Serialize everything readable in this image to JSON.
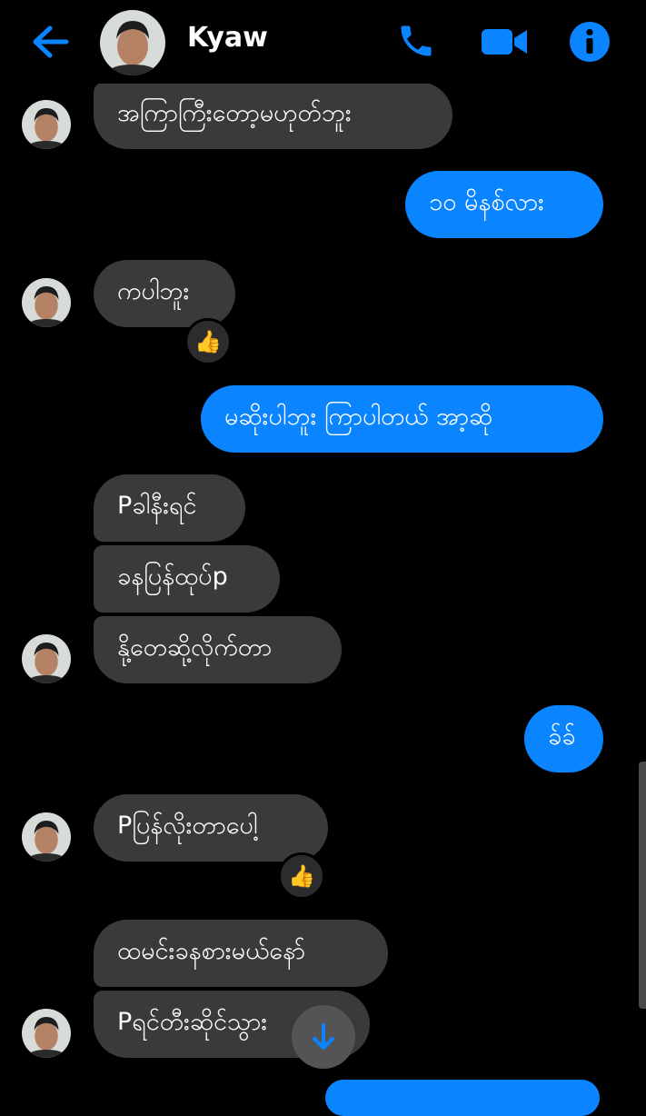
{
  "header": {
    "contact_name": "Kyaw",
    "accent_color": "#0a84ff",
    "icons": [
      "back-arrow-icon",
      "phone-icon",
      "video-camera-icon",
      "info-icon"
    ]
  },
  "messages": [
    {
      "from": "contact",
      "text": "အကြာကြီးတော့မဟုတ်ဘူး",
      "avatar": true
    },
    {
      "from": "me",
      "text": "၁၀ မိနစ်လား"
    },
    {
      "from": "contact",
      "text": "ကပါဘူး",
      "avatar": true,
      "reaction": "👍"
    },
    {
      "from": "me",
      "text": "မဆိုးပါဘူး ကြာပါတယ် အာ့ဆို"
    },
    {
      "from": "contact",
      "text": "Pခါနီးရင်"
    },
    {
      "from": "contact",
      "text": "ခနပြန်ထုပ်p"
    },
    {
      "from": "contact",
      "text": "နို့တေဆို့လိုက်တာ",
      "avatar": true
    },
    {
      "from": "me",
      "text": "ခ်ခ်"
    },
    {
      "from": "contact",
      "text": "Pပြန်လိုးတာပေါ့",
      "avatar": true,
      "reaction": "👍"
    },
    {
      "from": "contact",
      "text": "ထမင်းခနစားမယ်နော်"
    },
    {
      "from": "contact",
      "text": "Pရင်တီးဆိုင်သွား",
      "avatar": true
    }
  ]
}
